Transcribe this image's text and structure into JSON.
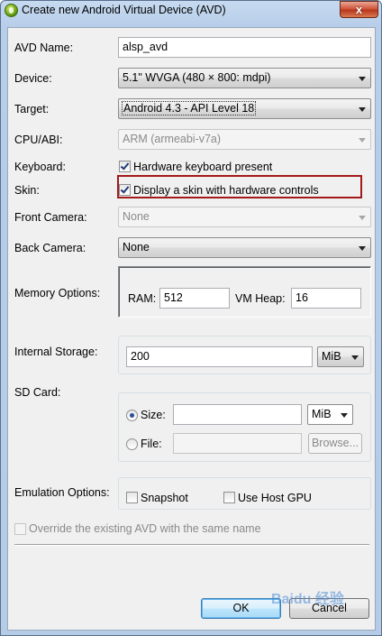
{
  "window": {
    "title": "Create new Android Virtual Device (AVD)",
    "close_glyph": "x"
  },
  "labels": {
    "avd_name": "AVD Name:",
    "device": "Device:",
    "target": "Target:",
    "cpu_abi": "CPU/ABI:",
    "keyboard": "Keyboard:",
    "skin": "Skin:",
    "front_camera": "Front Camera:",
    "back_camera": "Back Camera:",
    "memory_options": "Memory Options:",
    "internal_storage": "Internal Storage:",
    "sd_card": "SD Card:",
    "emulation_options": "Emulation Options:"
  },
  "values": {
    "avd_name": "alsp_avd",
    "device": "5.1\" WVGA (480 × 800: mdpi)",
    "target": "Android 4.3 - API Level 18",
    "cpu_abi": "ARM (armeabi-v7a)",
    "keyboard_checkbox": "Hardware keyboard present",
    "keyboard_checked": true,
    "skin_checkbox": "Display a skin with hardware controls",
    "skin_checked": true,
    "front_camera": "None",
    "back_camera": "None"
  },
  "memory": {
    "ram_label": "RAM:",
    "ram_value": "512",
    "vm_heap_label": "VM Heap:",
    "vm_heap_value": "16"
  },
  "internal_storage": {
    "value": "200",
    "unit": "MiB"
  },
  "sd_card": {
    "size_label": "Size:",
    "size_value": "",
    "size_unit": "MiB",
    "size_selected": true,
    "file_label": "File:",
    "file_value": "",
    "browse_label": "Browse..."
  },
  "emulation": {
    "snapshot_label": "Snapshot",
    "snapshot_checked": false,
    "gpu_label": "Use Host GPU",
    "gpu_checked": false
  },
  "override_label": "Override the existing AVD with the same name",
  "buttons": {
    "ok": "OK",
    "cancel": "Cancel"
  },
  "watermark": "Baidu 经验",
  "colors": {
    "highlight_border": "#a31a1a",
    "default_button": "#3c7fb1"
  }
}
